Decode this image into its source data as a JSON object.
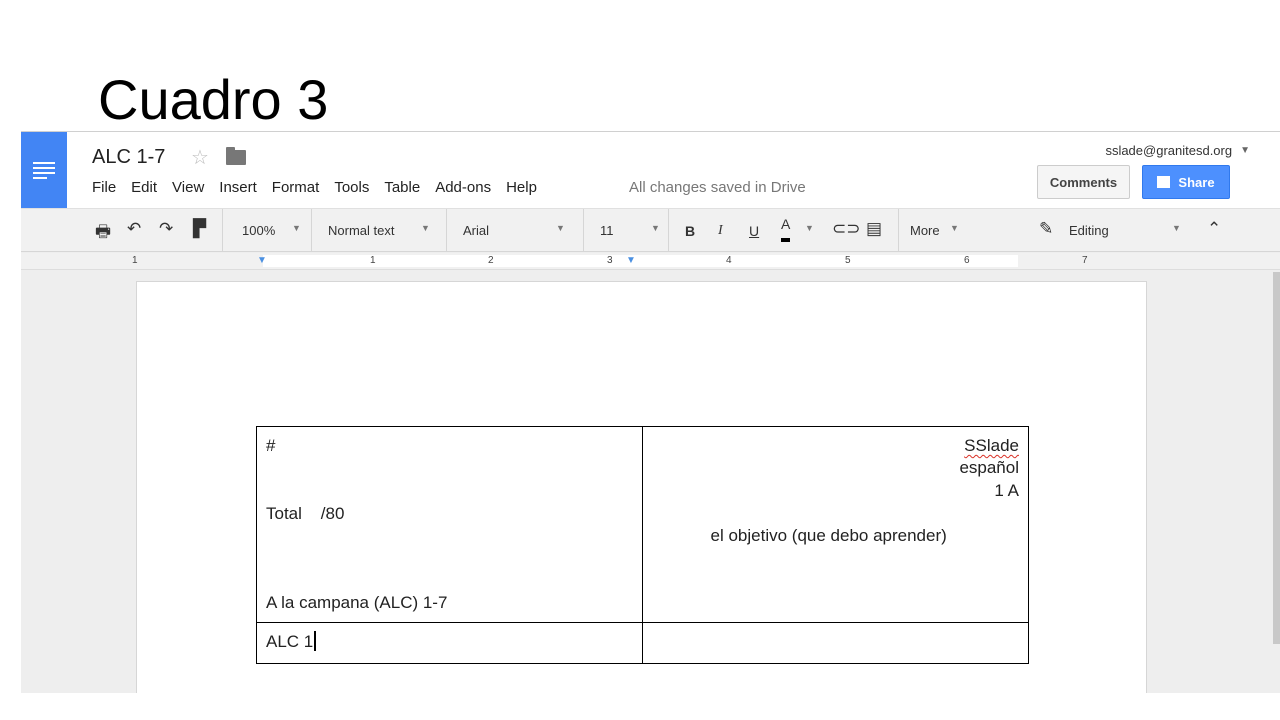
{
  "slide": {
    "title": "Cuadro 3"
  },
  "header": {
    "doc_title": "ALC 1-7",
    "account": "sslade@granitesd.org",
    "save_status": "All changes saved in Drive",
    "comments_label": "Comments",
    "share_label": "Share"
  },
  "menu": {
    "items": [
      "File",
      "Edit",
      "View",
      "Insert",
      "Format",
      "Tools",
      "Table",
      "Add-ons",
      "Help"
    ]
  },
  "toolbar": {
    "zoom": "100%",
    "style": "Normal text",
    "font": "Arial",
    "size": "11",
    "bold": "B",
    "italic": "I",
    "underline": "U",
    "text_color": "A",
    "more": "More",
    "mode": "Editing"
  },
  "ruler": {
    "numbers": [
      "1",
      "1",
      "2",
      "3",
      "4",
      "5",
      "6",
      "7"
    ]
  },
  "table": {
    "cell_left": {
      "hash": "#",
      "total": "Total    /80",
      "title": "A la campana (ALC) 1-7"
    },
    "cell_right": {
      "name": "SSlade",
      "subject": "español",
      "grade": "1 A",
      "objective": "el objetivo (que debo aprender)"
    },
    "row2_left": "ALC 1",
    "row2_right": ""
  },
  "colors": {
    "docs_blue": "#4285f4",
    "share_blue": "#4d90fe",
    "spell_red": "#d93025"
  },
  "icons": [
    "docs-logo-icon",
    "star-icon",
    "folder-icon",
    "print-icon",
    "undo-icon",
    "redo-icon",
    "paint-format-icon",
    "link-icon",
    "comment-icon",
    "pencil-icon",
    "collapse-icon"
  ]
}
